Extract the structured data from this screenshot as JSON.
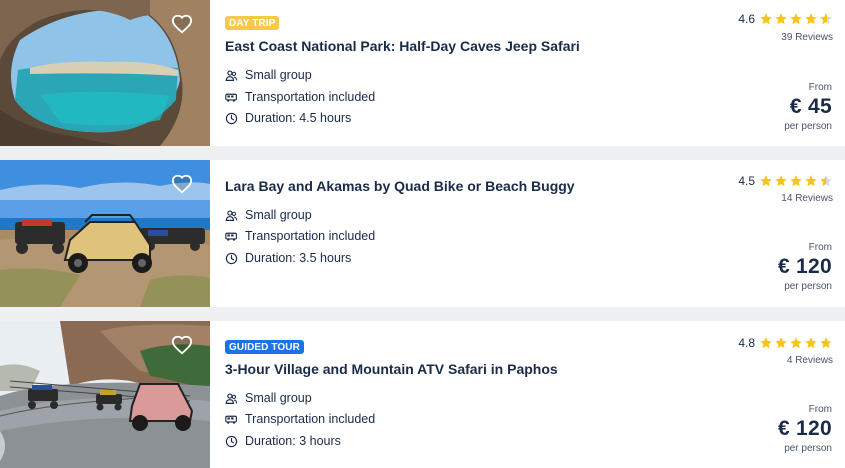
{
  "colors": {
    "star": "#f5c518",
    "badge_yellow": "#f7c948",
    "badge_blue": "#1a73e8",
    "text": "#1a2b49"
  },
  "tours": [
    {
      "badge": "DAY TRIP",
      "badge_color": "yellow",
      "title": "East Coast National Park: Half-Day Caves Jeep Safari",
      "features": [
        {
          "icon": "group-icon",
          "text": "Small group"
        },
        {
          "icon": "bus-icon",
          "text": "Transportation included"
        },
        {
          "icon": "clock-icon",
          "text": "Duration: 4.5 hours"
        }
      ],
      "rating": "4.6",
      "stars": 4.6,
      "reviews": "39 Reviews",
      "from": "From",
      "price": "€ 45",
      "per": "per person",
      "image": "sea-cave-photo"
    },
    {
      "badge": "",
      "badge_color": "",
      "title": "Lara Bay and Akamas by Quad Bike or Beach Buggy",
      "features": [
        {
          "icon": "group-icon",
          "text": "Small group"
        },
        {
          "icon": "bus-icon",
          "text": "Transportation included"
        },
        {
          "icon": "clock-icon",
          "text": "Duration: 3.5 hours"
        }
      ],
      "rating": "4.5",
      "stars": 4.5,
      "reviews": "14 Reviews",
      "from": "From",
      "price": "€ 120",
      "per": "per person",
      "image": "beach-buggies-photo"
    },
    {
      "badge": "GUIDED TOUR",
      "badge_color": "blue",
      "title": "3-Hour Village and Mountain ATV Safari in Paphos",
      "features": [
        {
          "icon": "group-icon",
          "text": "Small group"
        },
        {
          "icon": "bus-icon",
          "text": "Transportation included"
        },
        {
          "icon": "clock-icon",
          "text": "Duration: 3 hours"
        }
      ],
      "rating": "4.8",
      "stars": 4.8,
      "reviews": "4 Reviews",
      "from": "From",
      "price": "€ 120",
      "per": "per person",
      "image": "atv-road-photo"
    }
  ]
}
